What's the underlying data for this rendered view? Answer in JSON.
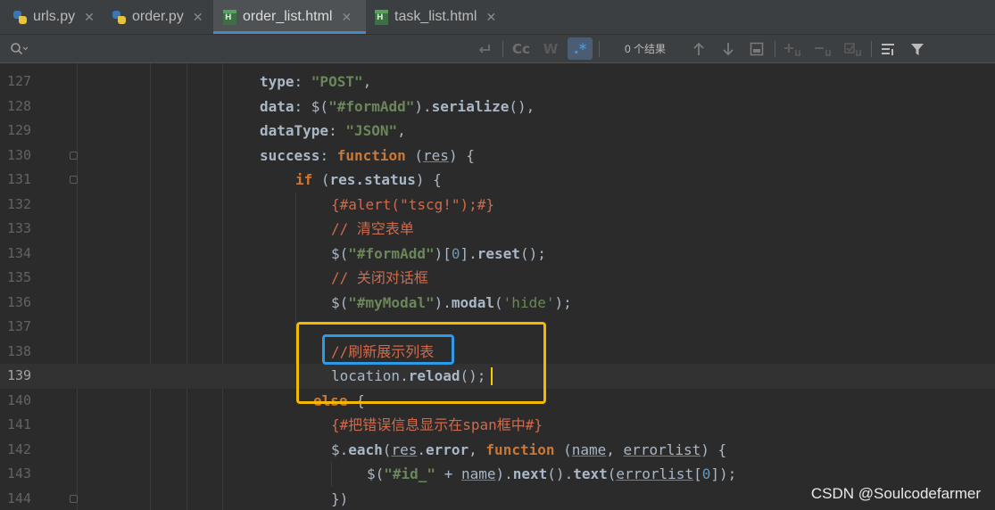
{
  "tabs": [
    {
      "label": "urls.py",
      "type": "py"
    },
    {
      "label": "order.py",
      "type": "py"
    },
    {
      "label": "order_list.html",
      "type": "html",
      "active": true
    },
    {
      "label": "task_list.html",
      "type": "html"
    }
  ],
  "search": {
    "result_count": "0 个结果",
    "match_case_label": "Cc",
    "words_label": "W",
    "regex_label": ".*"
  },
  "lines": [
    {
      "num": "127",
      "tokens": [
        [
          "prop",
          "type"
        ],
        [
          "plain",
          ": "
        ],
        [
          "str",
          "\"POST\""
        ],
        [
          "plain",
          ","
        ]
      ]
    },
    {
      "num": "128",
      "tokens": [
        [
          "prop",
          "data"
        ],
        [
          "plain",
          ": $("
        ],
        [
          "str",
          "\"#formAdd\""
        ],
        [
          "plain",
          ")."
        ],
        [
          "prop",
          "serialize"
        ],
        [
          "plain",
          "(),"
        ]
      ]
    },
    {
      "num": "129",
      "tokens": [
        [
          "prop",
          "dataType"
        ],
        [
          "plain",
          ": "
        ],
        [
          "str",
          "\"JSON\""
        ],
        [
          "plain",
          ","
        ]
      ]
    },
    {
      "num": "130",
      "tokens": [
        [
          "prop",
          "success"
        ],
        [
          "plain",
          ": "
        ],
        [
          "kw",
          "function"
        ],
        [
          "plain",
          " ("
        ],
        [
          "par",
          "res"
        ],
        [
          "plain",
          ") {"
        ]
      ]
    },
    {
      "num": "131",
      "tokens": [
        [
          "kw",
          "if"
        ],
        [
          "plain",
          " ("
        ],
        [
          "plainb",
          "res.status"
        ],
        [
          "plain",
          ") {"
        ]
      ]
    },
    {
      "num": "132",
      "tokens": [
        [
          "tpl",
          "{#alert(\"tscg!\");#}"
        ]
      ]
    },
    {
      "num": "133",
      "tokens": [
        [
          "cm",
          "// 清空表单"
        ]
      ]
    },
    {
      "num": "134",
      "tokens": [
        [
          "plain",
          "$("
        ],
        [
          "str",
          "\"#formAdd\""
        ],
        [
          "plain",
          ")["
        ],
        [
          "num",
          "0"
        ],
        [
          "plain",
          "]."
        ],
        [
          "prop",
          "reset"
        ],
        [
          "plain",
          "();"
        ]
      ]
    },
    {
      "num": "135",
      "tokens": [
        [
          "cm",
          "// 关闭对话框"
        ]
      ]
    },
    {
      "num": "136",
      "tokens": [
        [
          "plain",
          "$("
        ],
        [
          "str",
          "\"#myModal\""
        ],
        [
          "plain",
          ")."
        ],
        [
          "prop",
          "modal"
        ],
        [
          "plain",
          "("
        ],
        [
          "sq",
          "'hide'"
        ],
        [
          "plain",
          ");"
        ]
      ]
    },
    {
      "num": "137",
      "tokens": []
    },
    {
      "num": "138",
      "tokens": [
        [
          "cm",
          "//刷新展示列表"
        ]
      ]
    },
    {
      "num": "139",
      "tokens": [
        [
          "plain",
          "location."
        ],
        [
          "prop",
          "reload"
        ],
        [
          "plain",
          "();"
        ]
      ]
    },
    {
      "num": "140",
      "tokens": [
        [
          "kw",
          "else"
        ],
        [
          "plain",
          " {"
        ]
      ]
    },
    {
      "num": "141",
      "tokens": [
        [
          "tpl",
          "{#把错误信息显示在span框中#}"
        ]
      ]
    },
    {
      "num": "142",
      "tokens": [
        [
          "plain",
          "$."
        ],
        [
          "prop",
          "each"
        ],
        [
          "plain",
          "("
        ],
        [
          "par",
          "res"
        ],
        [
          "plain",
          "."
        ],
        [
          "prop",
          "error"
        ],
        [
          "plain",
          ", "
        ],
        [
          "kw",
          "function"
        ],
        [
          "plain",
          " ("
        ],
        [
          "par",
          "name"
        ],
        [
          "plain",
          ", "
        ],
        [
          "par",
          "errorlist"
        ],
        [
          "plain",
          ") {"
        ]
      ]
    },
    {
      "num": "143",
      "tokens": [
        [
          "plain",
          "$("
        ],
        [
          "str",
          "\"#id_\""
        ],
        [
          "plain",
          " + "
        ],
        [
          "par",
          "name"
        ],
        [
          "plain",
          ")."
        ],
        [
          "prop",
          "next"
        ],
        [
          "plain",
          "()."
        ],
        [
          "prop",
          "text"
        ],
        [
          "plain",
          "("
        ],
        [
          "par",
          "errorlist"
        ],
        [
          "plain",
          "["
        ],
        [
          "num",
          "0"
        ],
        [
          "plain",
          "]);"
        ]
      ]
    },
    {
      "num": "144",
      "tokens": [
        [
          "plain",
          "})"
        ]
      ]
    }
  ],
  "watermark": "CSDN @Soulcodefarmer"
}
